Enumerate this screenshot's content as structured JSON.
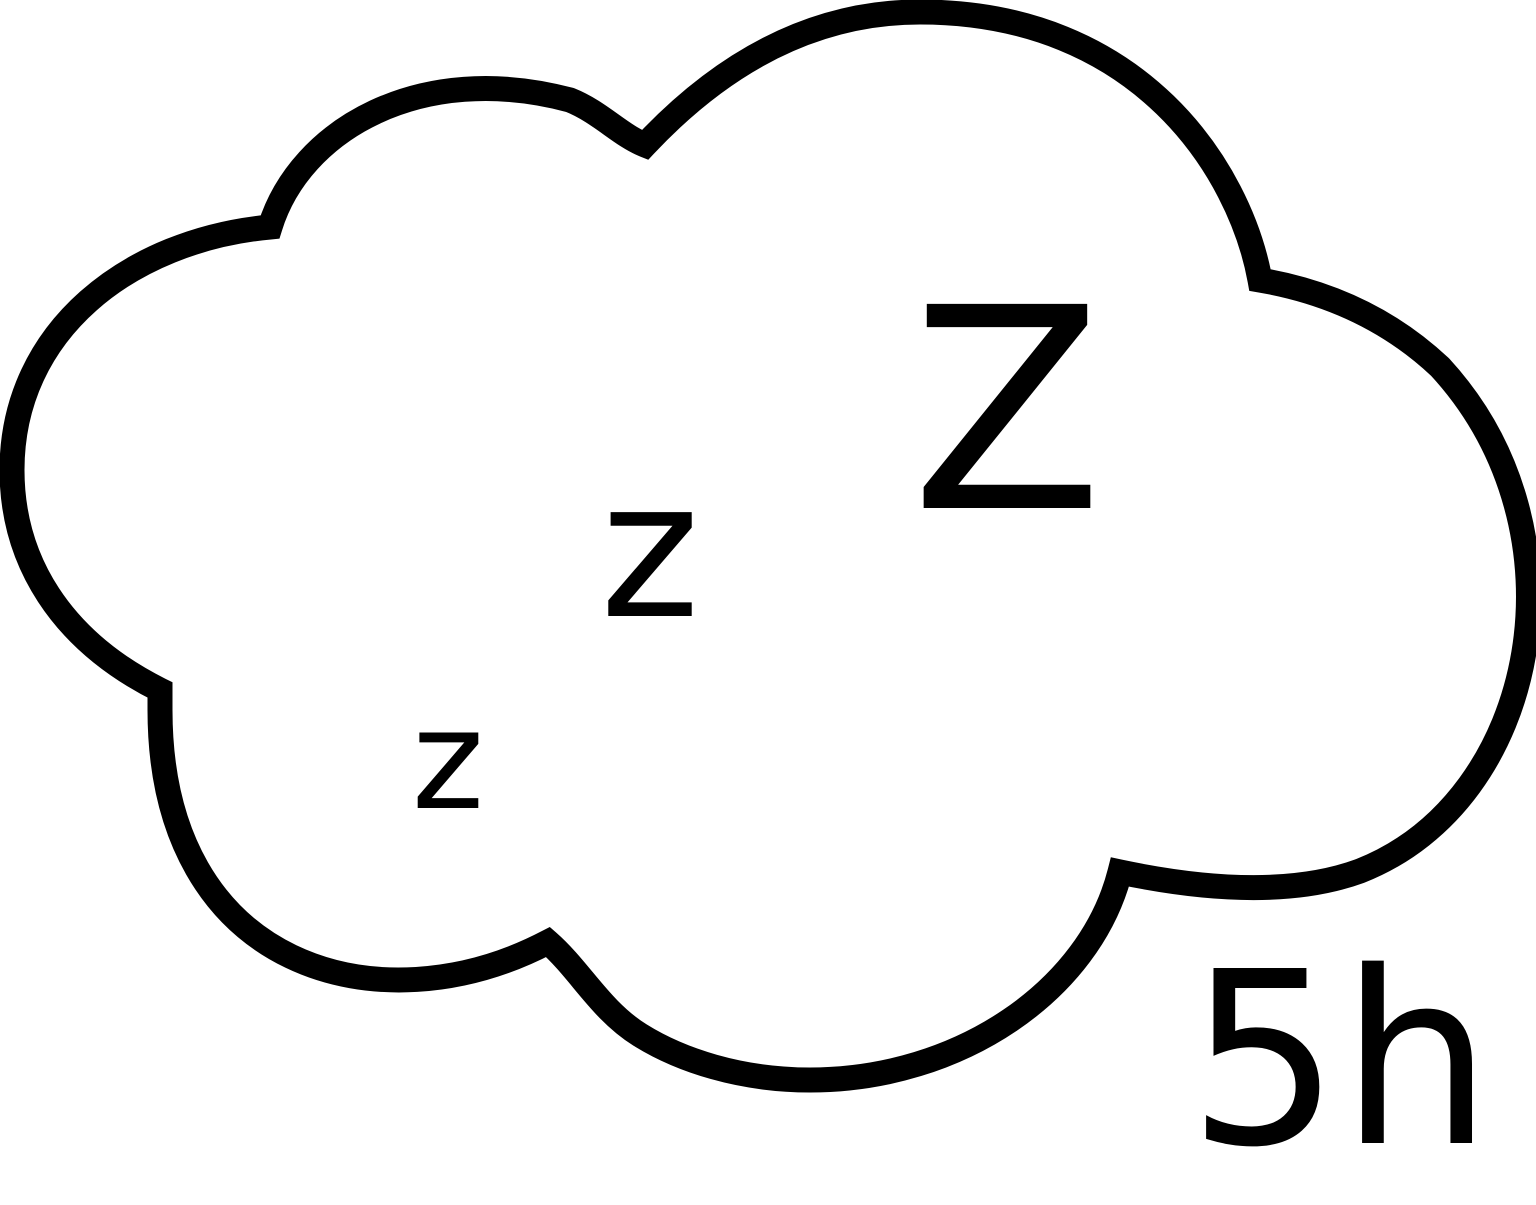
{
  "cloud": {
    "z_small": "z",
    "z_medium": "z",
    "z_large": "Z"
  },
  "duration_label": "5h",
  "colors": {
    "ink": "#000000",
    "background": "#ffffff"
  }
}
